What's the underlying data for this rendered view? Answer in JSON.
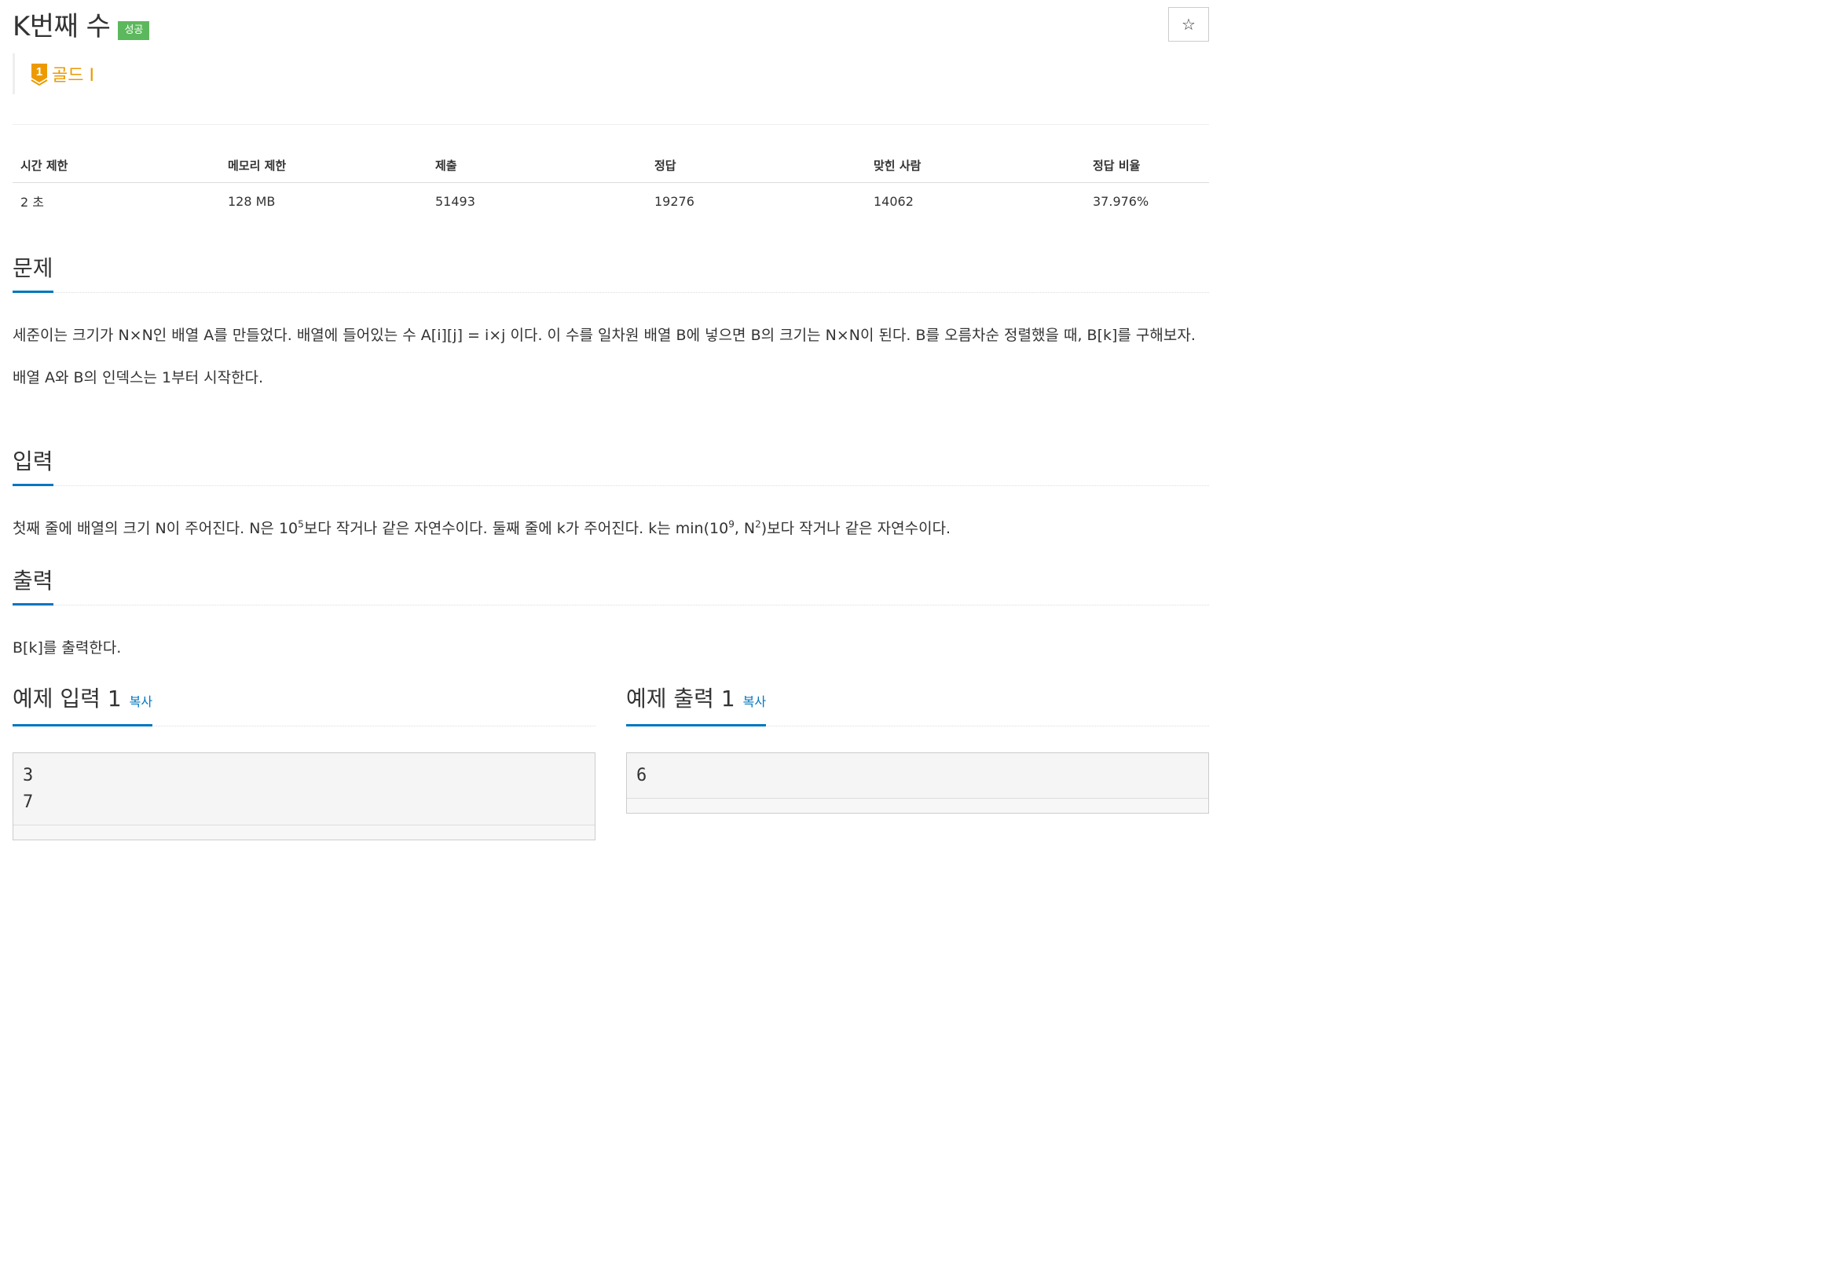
{
  "problem": {
    "title": "K번째 수",
    "status_badge": "성공",
    "star_icon": "☆",
    "tier": {
      "number": "1",
      "label": "골드 I",
      "color": "#ec9a00"
    }
  },
  "info_table": {
    "headers": [
      "시간 제한",
      "메모리 제한",
      "제출",
      "정답",
      "맞힌 사람",
      "정답 비율"
    ],
    "values": [
      "2 초",
      "128 MB",
      "51493",
      "19276",
      "14062",
      "37.976%"
    ]
  },
  "sections": {
    "description": {
      "title": "문제",
      "p1": "세준이는 크기가 N×N인 배열 A를 만들었다. 배열에 들어있는 수 A[i][j] = i×j 이다. 이 수를 일차원 배열 B에 넣으면 B의 크기는 N×N이 된다. B를 오름차순 정렬했을 때, B[k]를 구해보자.",
      "p2": "배열 A와 B의 인덱스는 1부터 시작한다."
    },
    "input": {
      "title": "입력",
      "part1": "첫째 줄에 배열의 크기 N이 주어진다. N은 10",
      "sup1": "5",
      "part2": "보다 작거나 같은 자연수이다. 둘째 줄에 k가 주어진다. k는 min(10",
      "sup2": "9",
      "part3": ", N",
      "sup3": "2",
      "part4": ")보다 작거나 같은 자연수이다."
    },
    "output": {
      "title": "출력",
      "text": "B[k]를 출력한다."
    }
  },
  "samples": {
    "input": {
      "title": "예제 입력 1",
      "copy": "복사",
      "text": "3\n7"
    },
    "output": {
      "title": "예제 출력 1",
      "copy": "복사",
      "text": "6"
    }
  },
  "colors": {
    "accent": "#0076c0",
    "success": "#5cb85c",
    "gold": "#ec9a00"
  }
}
